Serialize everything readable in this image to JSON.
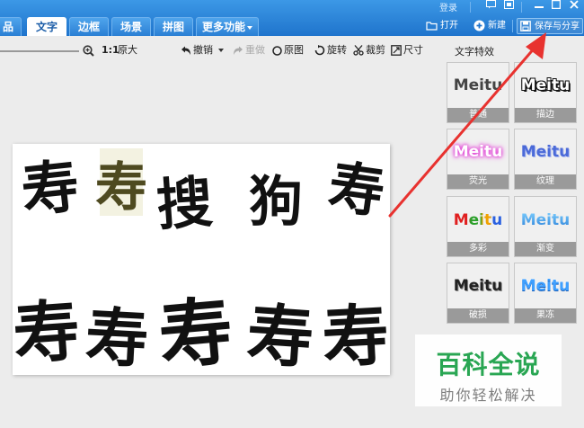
{
  "tabs": {
    "cut": "品",
    "text": "文字",
    "border": "边框",
    "scene": "场景",
    "puzzle": "拼图",
    "more": "更多功能"
  },
  "header": {
    "login": "登录",
    "open": "打开",
    "new": "新建",
    "save_share": "保存与分享"
  },
  "toolbar": {
    "ratio": "1:1",
    "original_size": "原大",
    "undo": "撤销",
    "redo": "重做",
    "original": "原图",
    "rotate": "旋转",
    "crop": "裁剪",
    "size": "尺寸"
  },
  "panel": {
    "title": "文字特效",
    "effects": [
      {
        "preview": "Meitu",
        "label": "普通"
      },
      {
        "preview": "Meitu",
        "label": "描边"
      },
      {
        "preview": "Meitu",
        "label": "荧光"
      },
      {
        "preview": "Meitu",
        "label": "纹理"
      },
      {
        "preview": "Meitu",
        "label": "多彩"
      },
      {
        "preview": "Meitu",
        "label": "渐变"
      },
      {
        "preview": "Meitu",
        "label": "破损"
      },
      {
        "preview": "Meitu",
        "label": "果冻"
      }
    ]
  },
  "canvas": {
    "row1": [
      "寿",
      "寿",
      "搜",
      "狗",
      "寿"
    ],
    "row2": [
      "寿",
      "寿",
      "寿",
      "寿",
      "寿"
    ]
  },
  "watermark": {
    "big": "百科全说",
    "small": "助你轻松解决"
  },
  "colors": {
    "accent": "#1f74cc",
    "arrow": "#e8322f",
    "watermark_green": "#29a653"
  }
}
